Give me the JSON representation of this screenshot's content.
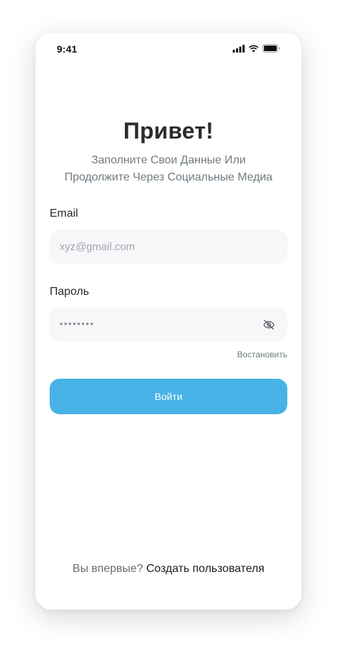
{
  "status_bar": {
    "time": "9:41",
    "icons": [
      "signal-icon",
      "wifi-icon",
      "battery-icon"
    ]
  },
  "heading": {
    "title": "Привет!",
    "subtitle_line1": "Заполните Свои Данные Или",
    "subtitle_line2": "Продолжите Через Социальные Медиа"
  },
  "form": {
    "email_label": "Email",
    "email_placeholder": "xyz@gmail.com",
    "email_value": "",
    "password_label": "Пароль",
    "password_masked": "••••••••",
    "password_visibility_icon": "eye-slash-icon",
    "restore_link": "Востановить",
    "submit_label": "Войти"
  },
  "footer": {
    "prompt": "Вы впервые?",
    "create_link": "Создать пользователя"
  },
  "colors": {
    "accent": "#48B2E7",
    "text_primary": "#2B2B2B",
    "text_secondary": "#707B81",
    "input_background": "#F7F7F9",
    "background": "#FFFFFF"
  }
}
